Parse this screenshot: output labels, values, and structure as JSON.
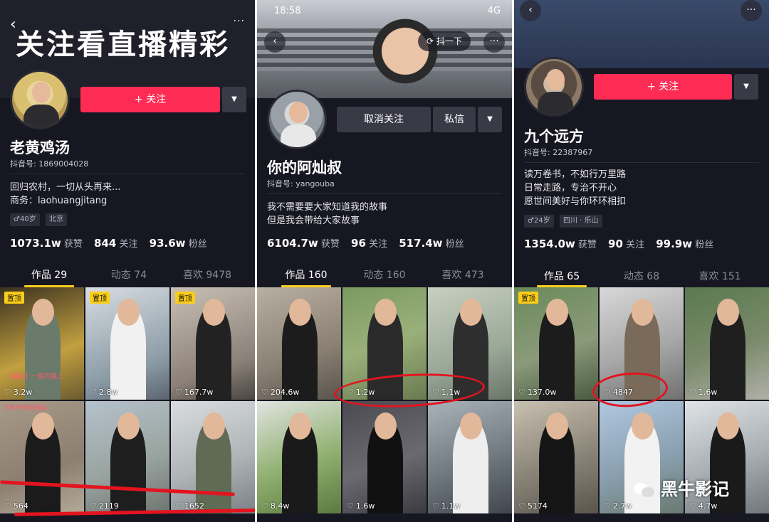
{
  "panels": [
    {
      "header_title": "关注看直播精彩",
      "follow_label": "+ 关注",
      "name": "老黄鸡汤",
      "douyin_id": "抖音号: 1869004028",
      "bio": [
        "回归农村，一切从头再来...",
        "商务：laohuangjitang"
      ],
      "tags": [
        "♂40岁",
        "北京"
      ],
      "stats": {
        "likes_num": "1073.1w",
        "likes_label": "获赞",
        "following_num": "844",
        "following_label": "关注",
        "fans_num": "93.6w",
        "fans_label": "粉丝"
      },
      "tabs": [
        "作品 29",
        "动态 74",
        "喜欢 9478"
      ],
      "videos": [
        {
          "likes": "3.2w",
          "pinned": "置顶",
          "overlay": "【捕捉】一直在路上"
        },
        {
          "likes": "2.8w",
          "pinned": "置顶"
        },
        {
          "likes": "167.7w",
          "pinned": "置顶"
        },
        {
          "likes": "564",
          "overlay": "之林寺挑战诸年"
        },
        {
          "likes": "2119"
        },
        {
          "likes": "1652"
        }
      ]
    },
    {
      "status_time": "18:58",
      "status_signal": "4G",
      "shake_label": "抖一下",
      "unfollow_label": "取消关注",
      "message_label": "私信",
      "name": "你的阿灿叔",
      "douyin_id": "抖音号: yangouba",
      "bio": [
        "我不需要要大家知道我的故事",
        "但是我会带给大家故事"
      ],
      "stats": {
        "likes_num": "6104.7w",
        "likes_label": "获赞",
        "following_num": "96",
        "following_label": "关注",
        "fans_num": "517.4w",
        "fans_label": "粉丝"
      },
      "tabs": [
        "作品 160",
        "动态 160",
        "喜欢 473"
      ],
      "videos": [
        {
          "likes": "204.6w"
        },
        {
          "likes": "1.2w"
        },
        {
          "likes": "1.1w"
        },
        {
          "likes": "8.4w"
        },
        {
          "likes": "1.6w"
        },
        {
          "likes": "1.1w"
        }
      ]
    },
    {
      "follow_label": "+ 关注",
      "name": "九个远方",
      "douyin_id": "抖音号: 22387967",
      "bio": [
        "读万卷书，不如行万里路",
        "日常走路，专治不开心",
        "愿世间美好与你环环相扣"
      ],
      "tags": [
        "♂24岁",
        "四川 · 乐山"
      ],
      "stats": {
        "likes_num": "1354.0w",
        "likes_label": "获赞",
        "following_num": "90",
        "following_label": "关注",
        "fans_num": "99.9w",
        "fans_label": "粉丝"
      },
      "tabs": [
        "作品 65",
        "动态 68",
        "喜欢 151"
      ],
      "videos": [
        {
          "likes": "137.0w",
          "pinned": "置顶"
        },
        {
          "likes": "4847"
        },
        {
          "likes": "1.6w"
        },
        {
          "likes": "5174"
        },
        {
          "likes": "2.7w"
        },
        {
          "likes": "4.7w"
        }
      ]
    }
  ],
  "watermark": "黑牛影记",
  "icons": {
    "back": "back-arrow-icon",
    "more": "more-dots-icon",
    "heart": "heart-outline-icon",
    "dropdown": "triangle-down-icon"
  }
}
